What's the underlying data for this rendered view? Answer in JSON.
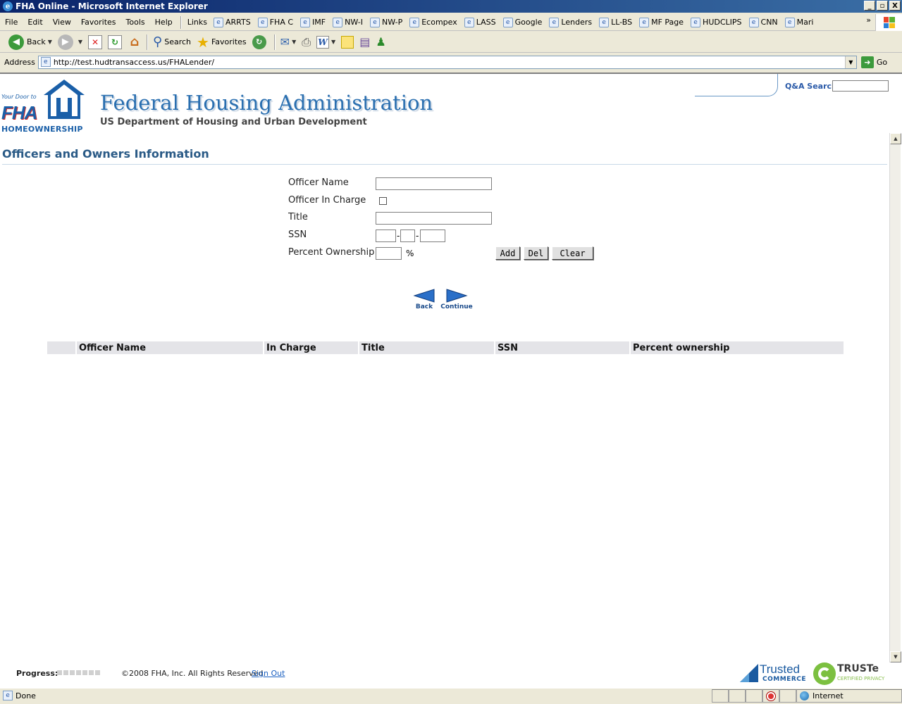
{
  "window": {
    "title": "FHA Online - Microsoft Internet Explorer",
    "buttons": [
      "_",
      "▫",
      "X"
    ]
  },
  "menu": [
    "File",
    "Edit",
    "View",
    "Favorites",
    "Tools",
    "Help"
  ],
  "links": {
    "label": "Links",
    "items": [
      "ARRTS",
      "FHA C",
      "IMF",
      "NW-I",
      "NW-P",
      "Ecompex",
      "LASS",
      "Google",
      "Lenders",
      "LL-BS",
      "MF Page",
      "HUDCLIPS",
      "CNN",
      "Mari"
    ],
    "overflow": "»"
  },
  "toolbar": {
    "back_label": "Back",
    "search_label": "Search",
    "favorites_label": "Favorites"
  },
  "address": {
    "label": "Address",
    "url": "http://test.hudtransaccess.us/FHALender/",
    "go_label": "Go"
  },
  "header": {
    "logo_tag": "Your Door to",
    "logo_fha": "FHA",
    "logo_home": "HOMEOWNERSHIP",
    "title": "Federal Housing Administration",
    "subtitle": "US Department of Housing and Urban Development",
    "qa_label": "Q&A Search:",
    "qa_value": ""
  },
  "page": {
    "heading": "Officers and Owners Information"
  },
  "form": {
    "officer_name_label": "Officer Name",
    "officer_name_value": "",
    "in_charge_label": "Officer In Charge",
    "in_charge_checked": false,
    "title_label": "Title",
    "title_value": "",
    "ssn_label": "SSN",
    "ssn_part1": "",
    "ssn_part2": "",
    "ssn_part3": "",
    "ssn_sep": "-",
    "percent_label": "Percent Ownership",
    "percent_value": "",
    "percent_sign": "%",
    "add_label": "Add",
    "del_label": "Del",
    "clear_label": "Clear"
  },
  "nav": {
    "back_label": "Back",
    "continue_label": "Continue"
  },
  "grid": {
    "columns": [
      "",
      "Officer Name",
      "In Charge",
      "Title",
      "SSN",
      "Percent ownership"
    ],
    "rows": []
  },
  "footer": {
    "progress_label": "Progress:",
    "copyright": "©2008 FHA, Inc. All Rights Reserved.",
    "signout_label": "Sign Out",
    "trusted_big": "Trusted",
    "trusted_small": "COMMERCE",
    "truste_big": "TRUSTe",
    "truste_small": "CERTIFIED PRIVACY"
  },
  "status": {
    "text": "Done",
    "zone": "Internet"
  },
  "colors": {
    "brand_blue": "#2a6fb0",
    "heading_blue": "#2a5a86",
    "grid_header_bg": "#e4e4e8"
  }
}
